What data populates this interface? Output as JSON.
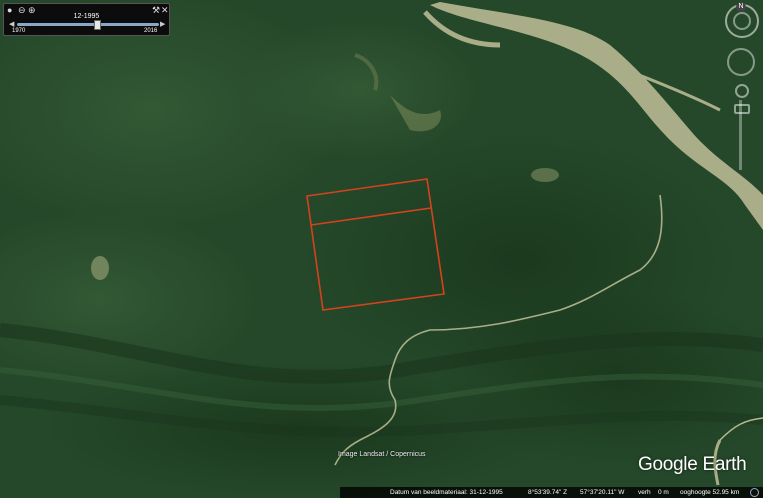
{
  "timeslider": {
    "current_date": "12-1995",
    "start_year": "1970",
    "end_year": "2016",
    "position_fraction": 0.56
  },
  "nav": {
    "north_label": "N"
  },
  "attribution": "Image Landsat / Copernicus",
  "logo": "Google Earth",
  "status": {
    "imagery_date": "Datum van beeldmateriaal: 31-12-1995",
    "latitude": "8°53'39.74\" Z",
    "longitude": "57°37'20.11\" W",
    "elevation_label": "verh",
    "elevation_value": "0 m",
    "eye_altitude": "ooghoogte  52.95 km"
  },
  "colors": {
    "forest": "#2a4d2e",
    "river": "#a9ae88",
    "overlay": "#d4421e"
  }
}
